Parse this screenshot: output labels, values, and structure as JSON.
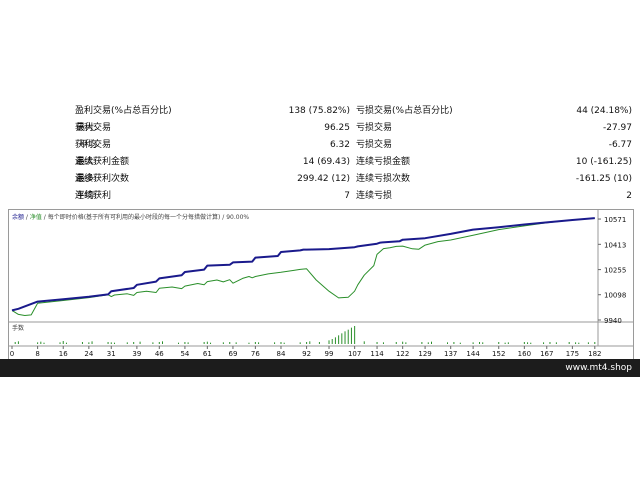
{
  "stats_rows": [
    {
      "prefix": "",
      "label1": "盈利交易(%占总百分比)",
      "value1": "138 (75.82%)",
      "label2": "亏损交易(%占总百分比)",
      "value2": "44 (24.18%)"
    },
    {
      "prefix": "最大:",
      "label1": "获利交易",
      "value1": "96.25",
      "label2": "亏损交易",
      "value2": "-27.97"
    },
    {
      "prefix": "平均",
      "label1": "获利交易",
      "value1": "6.32",
      "label2": "亏损交易",
      "value2": "-6.77"
    },
    {
      "prefix": "最大:",
      "label1": "连续获利金额",
      "value1": "14 (69.43)",
      "label2": "连续亏损金额",
      "value2": "10 (-161.25)"
    },
    {
      "prefix": "最多:",
      "label1": "连续获利次数",
      "value1": "299.42 (12)",
      "label2": "连续亏损次数",
      "value2": "-161.25 (10)"
    },
    {
      "prefix": "平均:",
      "label1": "连续获利",
      "value1": "7",
      "label2": "连续亏损",
      "value2": "2"
    }
  ],
  "chart_header": {
    "balance": "余额",
    "sep1": " / ",
    "equity": "净值",
    "sep2": " / ",
    "quality_text": "每个即时价格(基于所有可利用的最小时段的每一个分每措做计算) / 90.00%"
  },
  "volume_label": "手数",
  "footer_text": "www.mt4.shop",
  "colors": {
    "balance_line": "#1a1a8c",
    "equity_line": "#2a8f2a",
    "volume_bars": "#2a8f2a"
  },
  "chart_data": {
    "type": "line",
    "x_ticks": [
      0,
      8,
      16,
      24,
      31,
      39,
      46,
      54,
      61,
      69,
      76,
      84,
      92,
      99,
      107,
      114,
      122,
      129,
      137,
      144,
      152,
      160,
      167,
      175,
      182
    ],
    "y_ticks": [
      10571,
      10413,
      10255,
      10098,
      9940
    ],
    "ylim": [
      9940,
      10590
    ],
    "xlim": [
      0,
      183
    ],
    "series": [
      {
        "name": "余额",
        "x": [
          0,
          2,
          8,
          16,
          24,
          30,
          31,
          38,
          39,
          45,
          46,
          53,
          54,
          60,
          61,
          68,
          69,
          75,
          76,
          83,
          84,
          90,
          91,
          92,
          99,
          107,
          108,
          114,
          115,
          121,
          122,
          129,
          137,
          144,
          152,
          160,
          167,
          175,
          182
        ],
        "y": [
          10000,
          10010,
          10055,
          10070,
          10085,
          10100,
          10120,
          10140,
          10160,
          10180,
          10200,
          10220,
          10240,
          10255,
          10280,
          10285,
          10300,
          10305,
          10330,
          10340,
          10365,
          10375,
          10380,
          10380,
          10383,
          10395,
          10400,
          10417,
          10424,
          10432,
          10442,
          10451,
          10478,
          10505,
          10520,
          10537,
          10550,
          10565,
          10577
        ]
      },
      {
        "name": "净值",
        "x": [
          0,
          2,
          4,
          6,
          8,
          16,
          24,
          30,
          31,
          32,
          36,
          38,
          39,
          42,
          45,
          46,
          50,
          53,
          54,
          58,
          60,
          61,
          64,
          66,
          68,
          69,
          72,
          74,
          75,
          76,
          80,
          84,
          88,
          90,
          92,
          95,
          99,
          102,
          105,
          107,
          108,
          110,
          113,
          114,
          116,
          118,
          120,
          122,
          125,
          127,
          129,
          133,
          137,
          144,
          152,
          160,
          167,
          175,
          182
        ],
        "y": [
          10000,
          9975,
          9968,
          9972,
          10045,
          10062,
          10080,
          10098,
          10086,
          10096,
          10104,
          10094,
          10112,
          10120,
          10112,
          10138,
          10146,
          10136,
          10152,
          10168,
          10160,
          10180,
          10190,
          10178,
          10192,
          10170,
          10200,
          10212,
          10204,
          10212,
          10228,
          10238,
          10250,
          10256,
          10260,
          10190,
          10120,
          10078,
          10082,
          10120,
          10160,
          10220,
          10280,
          10350,
          10386,
          10392,
          10400,
          10402,
          10385,
          10382,
          10408,
          10430,
          10440,
          10470,
          10505,
          10528,
          10548,
          10565,
          10577
        ]
      }
    ],
    "volume": {
      "x": [
        1,
        2,
        8,
        9,
        10,
        15,
        16,
        17,
        22,
        24,
        25,
        30,
        31,
        32,
        36,
        38,
        40,
        44,
        46,
        47,
        52,
        54,
        55,
        60,
        61,
        62,
        66,
        68,
        70,
        74,
        76,
        77,
        82,
        84,
        85,
        90,
        92,
        93,
        96,
        99,
        100,
        101,
        102,
        103,
        104,
        105,
        106,
        107,
        110,
        114,
        116,
        120,
        122,
        123,
        128,
        130,
        131,
        136,
        138,
        140,
        144,
        146,
        147,
        152,
        154,
        155,
        160,
        161,
        162,
        166,
        168,
        170,
        174,
        176,
        177,
        180,
        182
      ],
      "y": [
        0.6,
        0.8,
        0.5,
        0.7,
        0.4,
        0.5,
        0.9,
        0.4,
        0.6,
        0.5,
        0.8,
        0.6,
        0.5,
        0.4,
        0.5,
        0.6,
        0.7,
        0.5,
        0.6,
        0.8,
        0.4,
        0.6,
        0.5,
        0.6,
        0.7,
        0.4,
        0.5,
        0.6,
        0.5,
        0.4,
        0.6,
        0.5,
        0.5,
        0.6,
        0.4,
        0.5,
        0.6,
        0.8,
        0.6,
        1.1,
        1.5,
        2.0,
        2.6,
        3.2,
        3.8,
        4.3,
        4.9,
        5.4,
        0.8,
        0.6,
        0.5,
        0.6,
        0.7,
        0.5,
        0.6,
        0.5,
        0.7,
        0.5,
        0.6,
        0.4,
        0.5,
        0.6,
        0.5,
        0.6,
        0.4,
        0.5,
        0.6,
        0.5,
        0.4,
        0.5,
        0.6,
        0.5,
        0.6,
        0.5,
        0.4,
        0.5,
        0.6
      ]
    }
  }
}
